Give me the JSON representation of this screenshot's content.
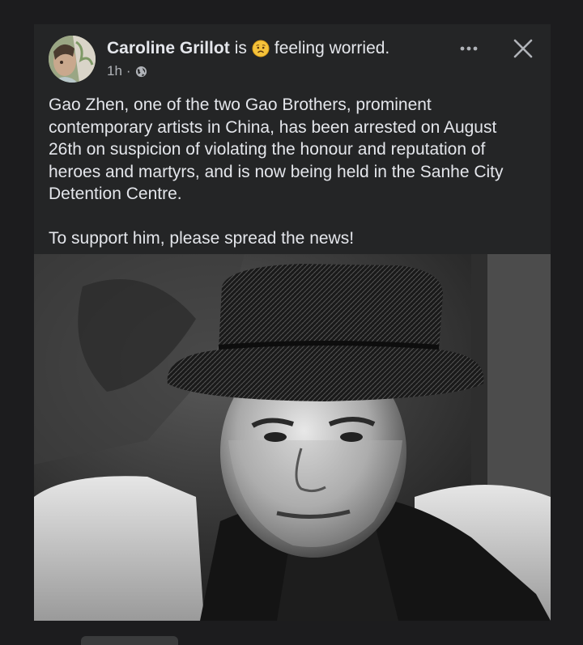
{
  "post": {
    "author": "Caroline Grillot",
    "is_text": "is",
    "feeling_text": "feeling worried.",
    "timestamp": "1h",
    "separator": "·",
    "body": "Gao Zhen, one of the two Gao Brothers, prominent contemporary artists in China, has been arrested on August 26th on suspicion of violating the honour and reputation of heroes and martyrs, and is now being held in the Sanhe City Detention Centre.\n\nTo support him, please spread the news!"
  },
  "icons": {
    "feeling": "worried-face-icon",
    "privacy": "globe-icon",
    "more": "more-options-icon",
    "close": "close-icon"
  },
  "colors": {
    "background": "#1c1c1e",
    "card": "#242526",
    "text": "#e4e6eb",
    "secondary_text": "#b0b3b8"
  }
}
